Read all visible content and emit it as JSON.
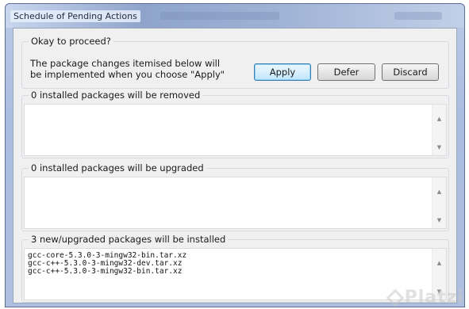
{
  "window": {
    "title": "Schedule of Pending Actions"
  },
  "confirm": {
    "legend": "Okay to proceed?",
    "line1": "The package changes itemised below will",
    "line2": "be implemented when you choose \"Apply\"",
    "apply_label": "Apply",
    "defer_label": "Defer",
    "discard_label": "Discard"
  },
  "removed": {
    "legend": "0 installed packages will be removed",
    "items": []
  },
  "upgraded": {
    "legend": "0 installed packages will be upgraded",
    "items": []
  },
  "installed": {
    "legend": "3 new/upgraded packages will be installed",
    "items": [
      "gcc-core-5.3.0-3-mingw32-bin.tar.xz",
      "gcc-c++-5.3.0-3-mingw32-dev.tar.xz",
      "gcc-c++-5.3.0-3-mingw32-bin.tar.xz"
    ]
  },
  "icons": {
    "scroll_up": "scroll-up-arrow-icon",
    "scroll_down": "scroll-down-arrow-icon"
  },
  "watermark": {
    "text": "Platzi"
  },
  "colors": {
    "titlebar": "#9fb3d6",
    "dialog_bg": "#f0f0f0",
    "default_button_border": "#3c7fb1"
  }
}
